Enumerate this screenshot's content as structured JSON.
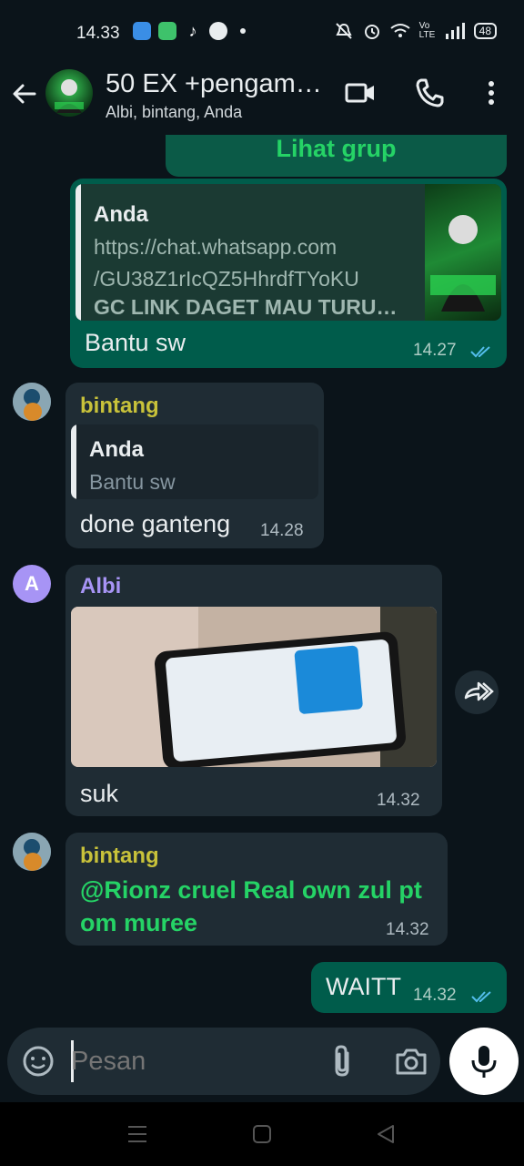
{
  "status": {
    "time": "14.33",
    "signal_label": "Vo LTE",
    "battery": "48"
  },
  "header": {
    "title": "50 EX +pengam…",
    "subtitle": "Albi, bintang, Anda"
  },
  "messages": {
    "group_link_button": "Lihat grup",
    "m1": {
      "quote_author": "Anda",
      "quote_url": "https://chat.whatsapp.com/GU38Z1rIcQZ5HhrdfTYoKU",
      "quote_url_line1": "https://chat.whatsapp.com",
      "quote_url_line2": "/GU38Z1rIcQZ5HhrdfTYoKU",
      "quote_extra": "GC LINK DAGET MAU TURU…",
      "text": "Bantu sw",
      "time": "14.27"
    },
    "m2": {
      "sender": "bintang",
      "quote_author": "Anda",
      "quote_text": "Bantu sw",
      "text": "done ganteng",
      "time": "14.28"
    },
    "m3": {
      "sender": "Albi",
      "avatar_letter": "A",
      "text": "suk",
      "time": "14.32"
    },
    "m4": {
      "sender": "bintang",
      "text": "@Rionz cruel Real own zul pt om muree",
      "text_line1": "@Rionz cruel Real own zul pt",
      "text_line2": "om muree",
      "time": "14.32"
    },
    "m5": {
      "text": "WAITT",
      "time": "14.32"
    }
  },
  "composer": {
    "placeholder": "Pesan"
  },
  "colors": {
    "background": "#0b141a",
    "bubble_out": "#005c4b",
    "bubble_in": "#1f2c34",
    "sender_bintang": "#c8c23a",
    "sender_albi": "#a794f5",
    "mention_green": "#25d366",
    "ticks_blue": "#53bdeb"
  }
}
